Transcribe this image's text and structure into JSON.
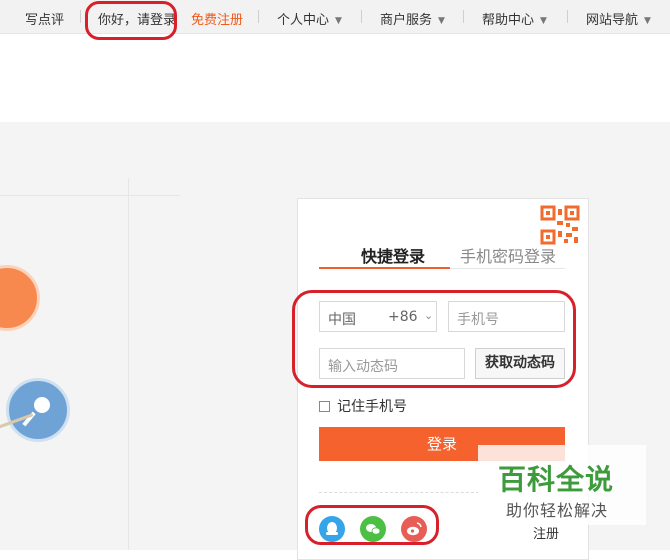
{
  "topbar": {
    "write_review": "写点评",
    "login_prompt": "你好，请登录",
    "register": "免费注册",
    "personal_center": "个人中心",
    "merchant_services": "商户服务",
    "help_center": "帮助中心",
    "site_nav": "网站导航"
  },
  "login": {
    "tab_quick": "快捷登录",
    "tab_password": "手机密码登录",
    "country": "中国",
    "country_code": "+86",
    "phone_placeholder": "手机号",
    "code_placeholder": "输入动态码",
    "get_code": "获取动态码",
    "remember_phone": "记住手机号",
    "submit": "登录",
    "register": "注册"
  },
  "watermark": {
    "title": "百科全说",
    "subtitle": "助你轻松解决"
  },
  "colors": {
    "accent": "#f5622d",
    "annotation": "#d7202a",
    "qq": "#35a4e8",
    "wechat": "#4cbf45",
    "weibo": "#e85d55"
  },
  "icons": [
    "chevron-down-icon",
    "qr-code-icon",
    "qq-icon",
    "wechat-icon",
    "weibo-icon"
  ]
}
